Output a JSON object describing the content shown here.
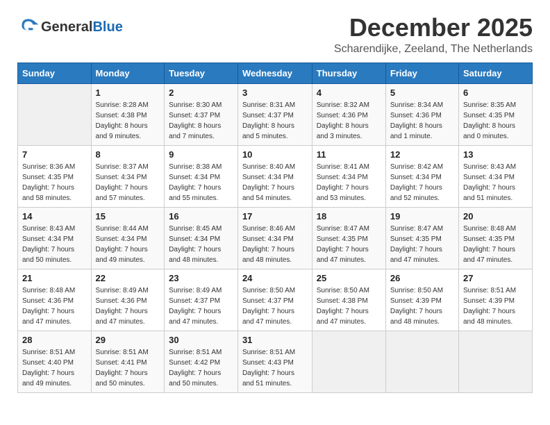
{
  "header": {
    "logo_line1": "General",
    "logo_line2": "Blue",
    "month": "December 2025",
    "location": "Scharendijke, Zeeland, The Netherlands"
  },
  "weekdays": [
    "Sunday",
    "Monday",
    "Tuesday",
    "Wednesday",
    "Thursday",
    "Friday",
    "Saturday"
  ],
  "weeks": [
    [
      {
        "day": "",
        "sunrise": "",
        "sunset": "",
        "daylight": ""
      },
      {
        "day": "1",
        "sunrise": "Sunrise: 8:28 AM",
        "sunset": "Sunset: 4:38 PM",
        "daylight": "Daylight: 8 hours and 9 minutes."
      },
      {
        "day": "2",
        "sunrise": "Sunrise: 8:30 AM",
        "sunset": "Sunset: 4:37 PM",
        "daylight": "Daylight: 8 hours and 7 minutes."
      },
      {
        "day": "3",
        "sunrise": "Sunrise: 8:31 AM",
        "sunset": "Sunset: 4:37 PM",
        "daylight": "Daylight: 8 hours and 5 minutes."
      },
      {
        "day": "4",
        "sunrise": "Sunrise: 8:32 AM",
        "sunset": "Sunset: 4:36 PM",
        "daylight": "Daylight: 8 hours and 3 minutes."
      },
      {
        "day": "5",
        "sunrise": "Sunrise: 8:34 AM",
        "sunset": "Sunset: 4:36 PM",
        "daylight": "Daylight: 8 hours and 1 minute."
      },
      {
        "day": "6",
        "sunrise": "Sunrise: 8:35 AM",
        "sunset": "Sunset: 4:35 PM",
        "daylight": "Daylight: 8 hours and 0 minutes."
      }
    ],
    [
      {
        "day": "7",
        "sunrise": "Sunrise: 8:36 AM",
        "sunset": "Sunset: 4:35 PM",
        "daylight": "Daylight: 7 hours and 58 minutes."
      },
      {
        "day": "8",
        "sunrise": "Sunrise: 8:37 AM",
        "sunset": "Sunset: 4:34 PM",
        "daylight": "Daylight: 7 hours and 57 minutes."
      },
      {
        "day": "9",
        "sunrise": "Sunrise: 8:38 AM",
        "sunset": "Sunset: 4:34 PM",
        "daylight": "Daylight: 7 hours and 55 minutes."
      },
      {
        "day": "10",
        "sunrise": "Sunrise: 8:40 AM",
        "sunset": "Sunset: 4:34 PM",
        "daylight": "Daylight: 7 hours and 54 minutes."
      },
      {
        "day": "11",
        "sunrise": "Sunrise: 8:41 AM",
        "sunset": "Sunset: 4:34 PM",
        "daylight": "Daylight: 7 hours and 53 minutes."
      },
      {
        "day": "12",
        "sunrise": "Sunrise: 8:42 AM",
        "sunset": "Sunset: 4:34 PM",
        "daylight": "Daylight: 7 hours and 52 minutes."
      },
      {
        "day": "13",
        "sunrise": "Sunrise: 8:43 AM",
        "sunset": "Sunset: 4:34 PM",
        "daylight": "Daylight: 7 hours and 51 minutes."
      }
    ],
    [
      {
        "day": "14",
        "sunrise": "Sunrise: 8:43 AM",
        "sunset": "Sunset: 4:34 PM",
        "daylight": "Daylight: 7 hours and 50 minutes."
      },
      {
        "day": "15",
        "sunrise": "Sunrise: 8:44 AM",
        "sunset": "Sunset: 4:34 PM",
        "daylight": "Daylight: 7 hours and 49 minutes."
      },
      {
        "day": "16",
        "sunrise": "Sunrise: 8:45 AM",
        "sunset": "Sunset: 4:34 PM",
        "daylight": "Daylight: 7 hours and 48 minutes."
      },
      {
        "day": "17",
        "sunrise": "Sunrise: 8:46 AM",
        "sunset": "Sunset: 4:34 PM",
        "daylight": "Daylight: 7 hours and 48 minutes."
      },
      {
        "day": "18",
        "sunrise": "Sunrise: 8:47 AM",
        "sunset": "Sunset: 4:35 PM",
        "daylight": "Daylight: 7 hours and 47 minutes."
      },
      {
        "day": "19",
        "sunrise": "Sunrise: 8:47 AM",
        "sunset": "Sunset: 4:35 PM",
        "daylight": "Daylight: 7 hours and 47 minutes."
      },
      {
        "day": "20",
        "sunrise": "Sunrise: 8:48 AM",
        "sunset": "Sunset: 4:35 PM",
        "daylight": "Daylight: 7 hours and 47 minutes."
      }
    ],
    [
      {
        "day": "21",
        "sunrise": "Sunrise: 8:48 AM",
        "sunset": "Sunset: 4:36 PM",
        "daylight": "Daylight: 7 hours and 47 minutes."
      },
      {
        "day": "22",
        "sunrise": "Sunrise: 8:49 AM",
        "sunset": "Sunset: 4:36 PM",
        "daylight": "Daylight: 7 hours and 47 minutes."
      },
      {
        "day": "23",
        "sunrise": "Sunrise: 8:49 AM",
        "sunset": "Sunset: 4:37 PM",
        "daylight": "Daylight: 7 hours and 47 minutes."
      },
      {
        "day": "24",
        "sunrise": "Sunrise: 8:50 AM",
        "sunset": "Sunset: 4:37 PM",
        "daylight": "Daylight: 7 hours and 47 minutes."
      },
      {
        "day": "25",
        "sunrise": "Sunrise: 8:50 AM",
        "sunset": "Sunset: 4:38 PM",
        "daylight": "Daylight: 7 hours and 47 minutes."
      },
      {
        "day": "26",
        "sunrise": "Sunrise: 8:50 AM",
        "sunset": "Sunset: 4:39 PM",
        "daylight": "Daylight: 7 hours and 48 minutes."
      },
      {
        "day": "27",
        "sunrise": "Sunrise: 8:51 AM",
        "sunset": "Sunset: 4:39 PM",
        "daylight": "Daylight: 7 hours and 48 minutes."
      }
    ],
    [
      {
        "day": "28",
        "sunrise": "Sunrise: 8:51 AM",
        "sunset": "Sunset: 4:40 PM",
        "daylight": "Daylight: 7 hours and 49 minutes."
      },
      {
        "day": "29",
        "sunrise": "Sunrise: 8:51 AM",
        "sunset": "Sunset: 4:41 PM",
        "daylight": "Daylight: 7 hours and 50 minutes."
      },
      {
        "day": "30",
        "sunrise": "Sunrise: 8:51 AM",
        "sunset": "Sunset: 4:42 PM",
        "daylight": "Daylight: 7 hours and 50 minutes."
      },
      {
        "day": "31",
        "sunrise": "Sunrise: 8:51 AM",
        "sunset": "Sunset: 4:43 PM",
        "daylight": "Daylight: 7 hours and 51 minutes."
      },
      {
        "day": "",
        "sunrise": "",
        "sunset": "",
        "daylight": ""
      },
      {
        "day": "",
        "sunrise": "",
        "sunset": "",
        "daylight": ""
      },
      {
        "day": "",
        "sunrise": "",
        "sunset": "",
        "daylight": ""
      }
    ]
  ]
}
